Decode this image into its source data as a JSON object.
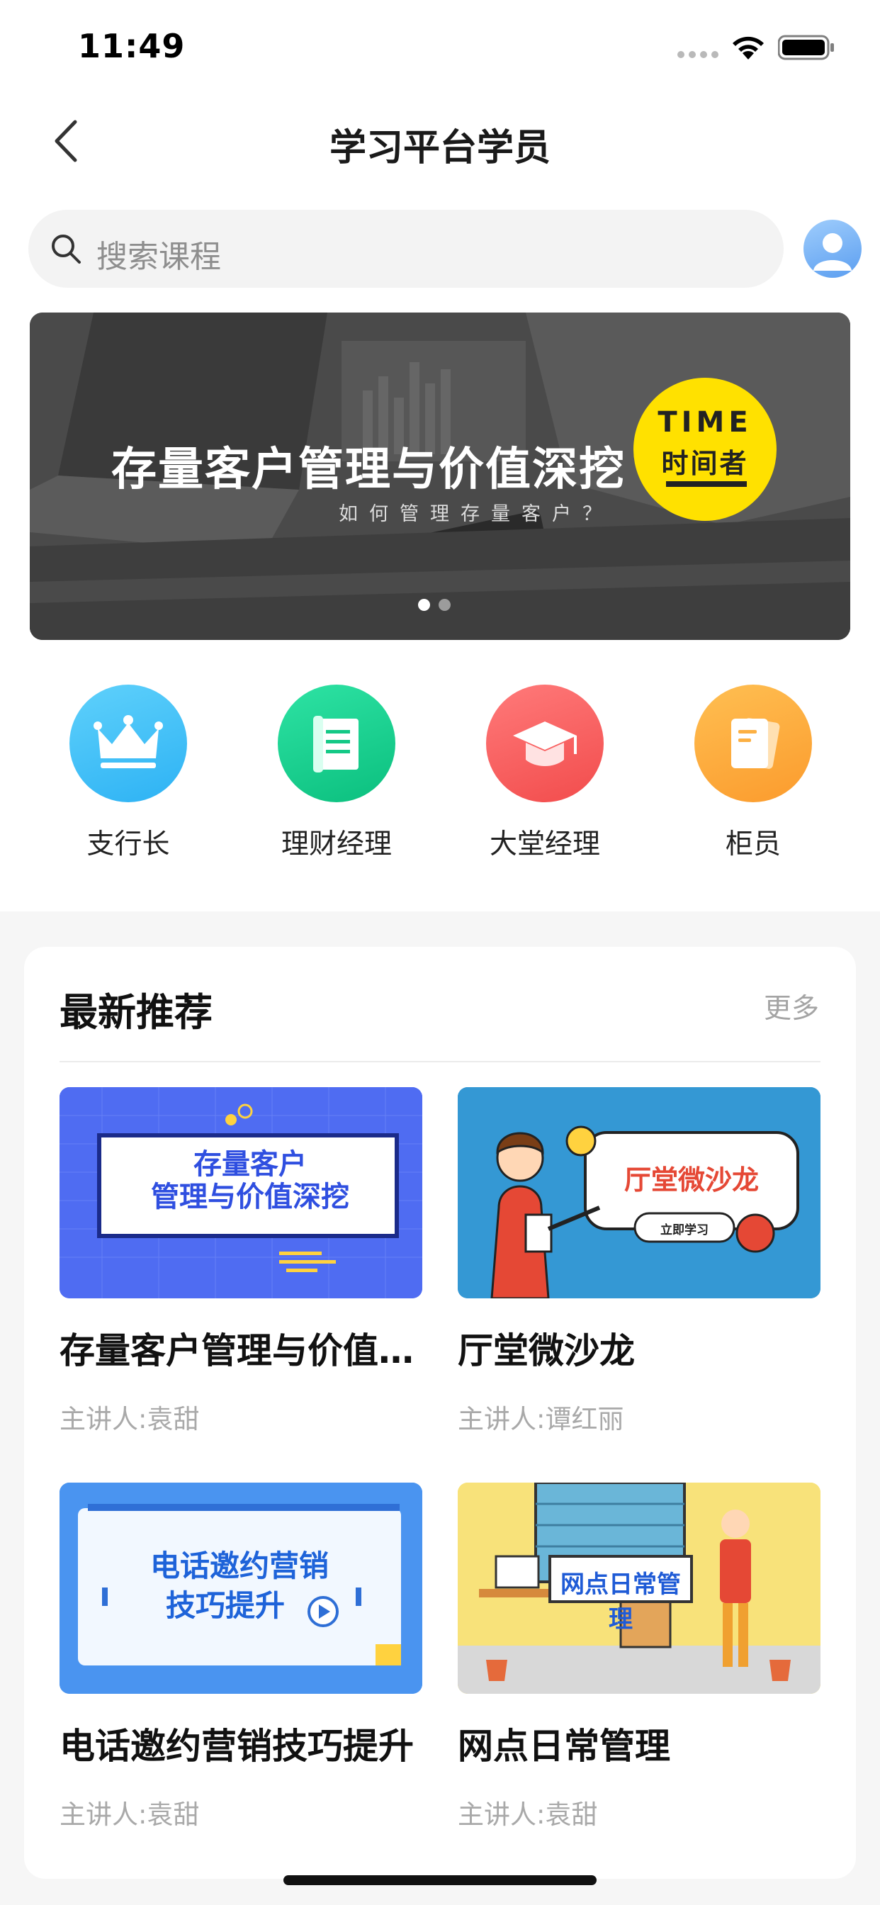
{
  "status": {
    "time": "11:49"
  },
  "nav": {
    "title": "学习平台学员"
  },
  "search": {
    "placeholder": "搜索课程"
  },
  "banner": {
    "title": "存量客户管理与价值深挖",
    "subtitle": "如何管理存量客户？",
    "badge_top": "TIME",
    "badge_bottom": "时间者"
  },
  "categories": [
    {
      "label": "支行长",
      "icon": "crown-icon",
      "color": "#3ec1f7"
    },
    {
      "label": "理财经理",
      "icon": "scroll-icon",
      "color": "#15d18f"
    },
    {
      "label": "大堂经理",
      "icon": "graduation-cap-icon",
      "color": "#fb5f5f"
    },
    {
      "label": "柜员",
      "icon": "document-icon",
      "color": "#fca53a"
    }
  ],
  "recommend": {
    "title": "最新推荐",
    "more": "更多",
    "courses": [
      {
        "title": "存量客户管理与价值深挖",
        "teacher": "主讲人:袁甜",
        "thumb_lines": [
          "存量客户",
          "管理与价值深挖"
        ]
      },
      {
        "title": "厅堂微沙龙",
        "teacher": "主讲人:谭红丽",
        "thumb_lines": [
          "厅堂微沙龙",
          "立即学习"
        ]
      },
      {
        "title": "电话邀约营销技巧提升",
        "teacher": "主讲人:袁甜",
        "thumb_lines": [
          "电话邀约营销",
          "技巧提升"
        ]
      },
      {
        "title": "网点日常管理",
        "teacher": "主讲人:袁甜",
        "thumb_lines": [
          "网点日常管理"
        ]
      }
    ]
  }
}
